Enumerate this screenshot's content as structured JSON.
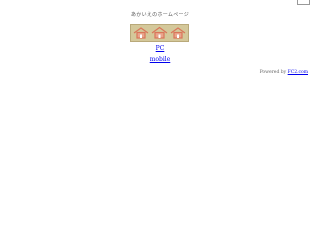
{
  "site": {
    "title": "あかいえのホームページ"
  },
  "banner": {
    "icon": "house-icons-banner",
    "background_color": "#d4c89a",
    "house_color": "#d9765a"
  },
  "nav": {
    "pc_label": "PC",
    "mobile_label": "mobile"
  },
  "footer": {
    "powered_prefix": "Powered by",
    "powered_link": "FC2.com"
  },
  "colors": {
    "link": "#0000ee",
    "text": "#555555"
  }
}
